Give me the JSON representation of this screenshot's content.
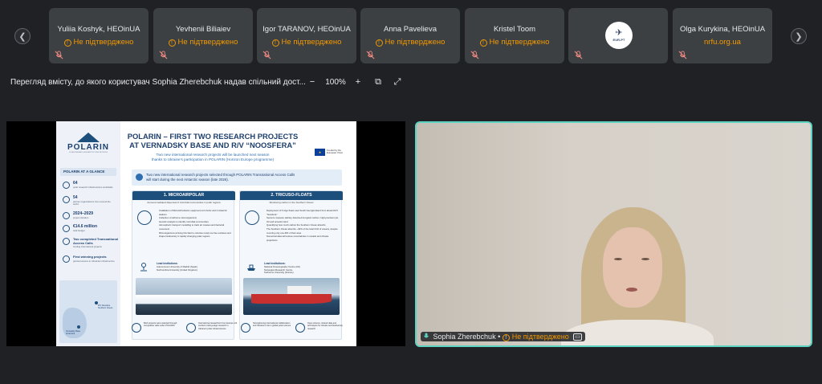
{
  "participants": [
    {
      "name": "Yuliia Koshyk, HEOinUA",
      "status": "Не підтверджено",
      "has_warning": true
    },
    {
      "name": "Yevhenii Biliaiev",
      "status": "Не підтверджено",
      "has_warning": true
    },
    {
      "name": "Igor  TARANOV, HEOinUA",
      "status": "Не підтверджено",
      "has_warning": true
    },
    {
      "name": "Anna Pavelieva",
      "status": "Не підтверджено",
      "has_warning": true
    },
    {
      "name": "Kristel Toom",
      "status": "Не підтверджено",
      "has_warning": true
    },
    {
      "name": "",
      "logo_text": "EUR-PT",
      "status": ""
    },
    {
      "name": "Olga Kurykina, HEOinUA",
      "status": "nrfu.org.ua",
      "has_warning": false
    }
  ],
  "nav": {
    "prev_icon": "chevron-left-icon",
    "next_icon": "chevron-right-icon",
    "prev_glyph": "❮",
    "next_glyph": "❯"
  },
  "toolbar": {
    "share_title": "Перегляд вмісту, до якого користувач Sophia Zherebchuk надав спільний дост...",
    "zoom_out": "−",
    "zoom_level": "100%",
    "zoom_in": "+",
    "fit_glyph": "⧉",
    "expand_glyph": "⤢"
  },
  "slide": {
    "logo": "POLARIN",
    "logo_tagline": "POLAR RESEARCH INFRASTRUCTURE NETWORK",
    "glance_title": "POLARIN AT A GLANCE",
    "stats": [
      {
        "value": "64",
        "text": "polar research infrastructures worldwide"
      },
      {
        "value": "54",
        "text": "partner organisations from around the world"
      },
      {
        "value": "2024–2029",
        "text": "project duration"
      },
      {
        "value": "€14.6 million",
        "text": "total budget"
      },
      {
        "value": "Two completed Transnational Access Calls",
        "text": "funding international projects"
      },
      {
        "value": "First winning projects",
        "text": "granted access to Ukrainian infrastructure"
      }
    ],
    "map_labels": [
      "Vernadsky Base Antarctica",
      "R/V Noosfera Southern Ocean"
    ],
    "title_line1": "POLARIN – FIRST TWO RESEARCH PROJECTS",
    "title_line2": "AT VERNADSKY BASE AND R/V “NOOSFERA”",
    "subtitle_line1": "Two new international research projects will be launched next season",
    "subtitle_line2": "thanks to Ukraine's participation in POLARIN (Horizon Europe programme)",
    "eu_text": "Funded by the European Union",
    "banner_line1": "Two new international research projects selected through POLARIN Transnational Access Calls",
    "banner_line2": "will start during the next Antarctic season (late 2026).",
    "projects": [
      {
        "heading": "1. MICROAIRPOLAR",
        "sub": "Aerosol-mediated dispersal of microbial communities in polar regions",
        "bullets": [
          "Installation of MicroAirCollector equipment at 3 Arctic and 3 Antarctic stations",
          "Collection of airborne microorganisms",
          "Genetic analysis to identify microbial communities",
          "Atmospheric transport modelling to track air masses and bacterial movement",
          "Microorganisms arriving this field to colonise newly ice-free surfaces and shape biodiversity in rapidly changing polar regions"
        ],
        "lead_label": "Lead institutions:",
        "lead": [
          "Autonomous University of Madrid (Spain)",
          "Northumbria University (United Kingdom)"
        ]
      },
      {
        "heading": "2. TRICUSO-FLOATS",
        "sub": "Monitoring carbon in the Southern Ocean",
        "bullets": [
          "Deployment of 6 Argo floats near South Georgia Island from aboard R/V \"Noosfera\"",
          "Sensors measure salinity, dissolved inorganic carbon, high-precision pH, O2 and acoustic wind",
          "Quantifying how much carbon the Southern Ocean absorbs",
          "The Southern Ocean absorbs ~40% of the total CO2 of oceans, despite covering only one-fifth of their area",
          "Numerical data will reduce uncertainties in models and climate projections"
        ],
        "lead_label": "Lead institutions:",
        "lead": [
          "National Oceanography Centre (UK)",
          "Norwegian Research Centre",
          "Sorbonne University (France)"
        ]
      }
    ],
    "bottom_items": [
      "Both projects were selected through competitive calls under POLARIN",
      "International researchers from Europe will conduct cutting-edge research in Ukraine's polar infrastructures",
      "Strengthening international collaboration and Ukraine's role in global polar science",
      "Open science, shared data and techniques for climate and biodiversity research"
    ]
  },
  "speaker": {
    "name": "Sophia Zherebchuk",
    "status": "Не підтверджено",
    "cc": "▭"
  },
  "colors": {
    "accent_border": "#5bd3c0",
    "warning": "#f29900",
    "background": "#202124",
    "tile": "#3c4043"
  }
}
